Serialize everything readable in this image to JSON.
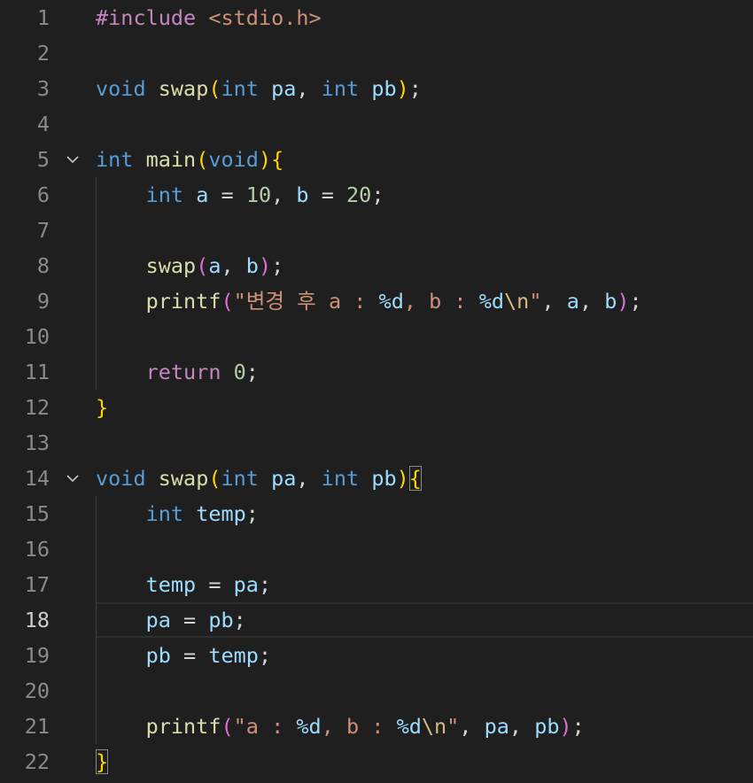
{
  "editor": {
    "theme_background": "#1f1f1f",
    "colors": {
      "keyword": "#569cd6",
      "control": "#c586c0",
      "function": "#dcdcaa",
      "variable": "#9cdcfe",
      "number": "#b5cea8",
      "string": "#ce9178",
      "bracket_level1": "#ffd700",
      "bracket_level2": "#da70d6"
    },
    "active_line": 18,
    "lines": [
      {
        "num": "1",
        "tokens": [
          [
            "inc",
            "#include "
          ],
          [
            "str",
            "<stdio.h>"
          ]
        ]
      },
      {
        "num": "2",
        "tokens": []
      },
      {
        "num": "3",
        "tokens": [
          [
            "kw",
            "void"
          ],
          [
            "op",
            " "
          ],
          [
            "fn",
            "swap"
          ],
          [
            "br1",
            "("
          ],
          [
            "kw",
            "int"
          ],
          [
            "op",
            " "
          ],
          [
            "var",
            "pa"
          ],
          [
            "op",
            ", "
          ],
          [
            "kw",
            "int"
          ],
          [
            "op",
            " "
          ],
          [
            "var",
            "pb"
          ],
          [
            "br1",
            ")"
          ],
          [
            "op",
            ";"
          ]
        ]
      },
      {
        "num": "4",
        "tokens": []
      },
      {
        "num": "5",
        "fold": true,
        "tokens": [
          [
            "kw",
            "int"
          ],
          [
            "op",
            " "
          ],
          [
            "fn",
            "main"
          ],
          [
            "br1",
            "("
          ],
          [
            "kw",
            "void"
          ],
          [
            "br1",
            ")"
          ],
          [
            "br1",
            "{"
          ]
        ]
      },
      {
        "num": "6",
        "tokens": [
          [
            "op",
            "    "
          ],
          [
            "kw",
            "int"
          ],
          [
            "op",
            " "
          ],
          [
            "var",
            "a"
          ],
          [
            "op",
            " = "
          ],
          [
            "num",
            "10"
          ],
          [
            "op",
            ", "
          ],
          [
            "var",
            "b"
          ],
          [
            "op",
            " = "
          ],
          [
            "num",
            "20"
          ],
          [
            "op",
            ";"
          ]
        ]
      },
      {
        "num": "7",
        "tokens": []
      },
      {
        "num": "8",
        "tokens": [
          [
            "op",
            "    "
          ],
          [
            "fn",
            "swap"
          ],
          [
            "br2",
            "("
          ],
          [
            "var",
            "a"
          ],
          [
            "op",
            ", "
          ],
          [
            "var",
            "b"
          ],
          [
            "br2",
            ")"
          ],
          [
            "op",
            ";"
          ]
        ]
      },
      {
        "num": "9",
        "tokens": [
          [
            "op",
            "    "
          ],
          [
            "fn",
            "printf"
          ],
          [
            "br2",
            "("
          ],
          [
            "str",
            "\"변경 후 a : "
          ],
          [
            "fmt",
            "%d"
          ],
          [
            "str",
            ", b : "
          ],
          [
            "fmt",
            "%d"
          ],
          [
            "esc",
            "\\n"
          ],
          [
            "str",
            "\""
          ],
          [
            "op",
            ", "
          ],
          [
            "var",
            "a"
          ],
          [
            "op",
            ", "
          ],
          [
            "var",
            "b"
          ],
          [
            "br2",
            ")"
          ],
          [
            "op",
            ";"
          ]
        ]
      },
      {
        "num": "10",
        "tokens": []
      },
      {
        "num": "11",
        "tokens": [
          [
            "op",
            "    "
          ],
          [
            "ctl",
            "return"
          ],
          [
            "op",
            " "
          ],
          [
            "num",
            "0"
          ],
          [
            "op",
            ";"
          ]
        ]
      },
      {
        "num": "12",
        "tokens": [
          [
            "br1",
            "}"
          ]
        ]
      },
      {
        "num": "13",
        "tokens": []
      },
      {
        "num": "14",
        "fold": true,
        "tokens": [
          [
            "kw",
            "void"
          ],
          [
            "op",
            " "
          ],
          [
            "fn",
            "swap"
          ],
          [
            "br1",
            "("
          ],
          [
            "kw",
            "int"
          ],
          [
            "op",
            " "
          ],
          [
            "var",
            "pa"
          ],
          [
            "op",
            ", "
          ],
          [
            "kw",
            "int"
          ],
          [
            "op",
            " "
          ],
          [
            "var",
            "pb"
          ],
          [
            "br1",
            ")"
          ],
          [
            "br1bm",
            "{"
          ]
        ]
      },
      {
        "num": "15",
        "tokens": [
          [
            "op",
            "    "
          ],
          [
            "kw",
            "int"
          ],
          [
            "op",
            " "
          ],
          [
            "var",
            "temp"
          ],
          [
            "op",
            ";"
          ]
        ]
      },
      {
        "num": "16",
        "tokens": []
      },
      {
        "num": "17",
        "tokens": [
          [
            "op",
            "    "
          ],
          [
            "var",
            "temp"
          ],
          [
            "op",
            " = "
          ],
          [
            "var",
            "pa"
          ],
          [
            "op",
            ";"
          ]
        ]
      },
      {
        "num": "18",
        "tokens": [
          [
            "op",
            "    "
          ],
          [
            "var",
            "pa"
          ],
          [
            "op",
            " = "
          ],
          [
            "var",
            "pb"
          ],
          [
            "op",
            ";"
          ]
        ]
      },
      {
        "num": "19",
        "tokens": [
          [
            "op",
            "    "
          ],
          [
            "var",
            "pb"
          ],
          [
            "op",
            " = "
          ],
          [
            "var",
            "temp"
          ],
          [
            "op",
            ";"
          ]
        ]
      },
      {
        "num": "20",
        "tokens": []
      },
      {
        "num": "21",
        "tokens": [
          [
            "op",
            "    "
          ],
          [
            "fn",
            "printf"
          ],
          [
            "br2",
            "("
          ],
          [
            "str",
            "\"a : "
          ],
          [
            "fmt",
            "%d"
          ],
          [
            "str",
            ", b : "
          ],
          [
            "fmt",
            "%d"
          ],
          [
            "esc",
            "\\n"
          ],
          [
            "str",
            "\""
          ],
          [
            "op",
            ", "
          ],
          [
            "var",
            "pa"
          ],
          [
            "op",
            ", "
          ],
          [
            "var",
            "pb"
          ],
          [
            "br2",
            ")"
          ],
          [
            "op",
            ";"
          ]
        ]
      },
      {
        "num": "22",
        "tokens": [
          [
            "br1bm",
            "}"
          ]
        ]
      }
    ]
  }
}
